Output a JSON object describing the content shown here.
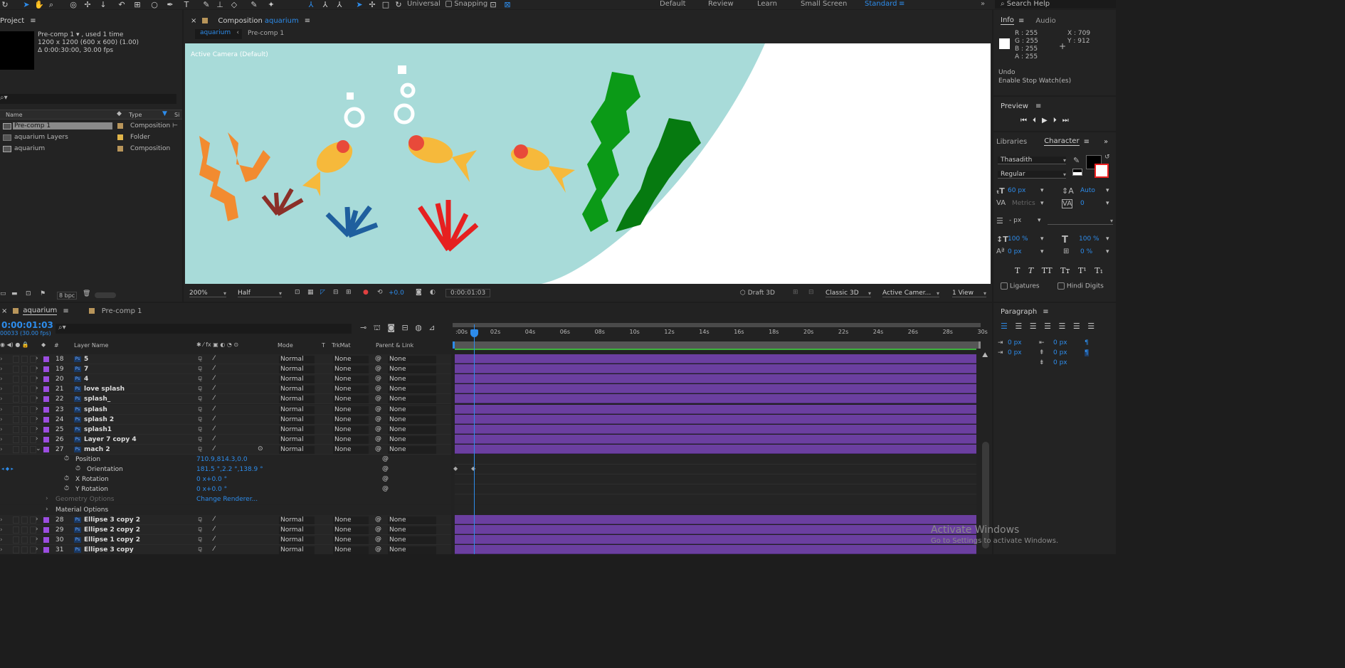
{
  "toolbar": {
    "universal": "Universal",
    "snapping": "Snapping"
  },
  "workspaces": [
    "Default",
    "Review",
    "Learn",
    "Small Screen",
    "Standard"
  ],
  "search_help": "Search Help",
  "project": {
    "title": "Project",
    "item_name": "Pre-comp 1 ▾ , used 1 time",
    "item_dims": "1200 x 1200  (600 x 600) (1.00)",
    "item_dur": "Δ 0:00:30:00, 30.00 fps",
    "col_name": "Name",
    "col_type": "Type",
    "col_size": "Si",
    "items": [
      {
        "name": "Pre-comp 1",
        "type": "Composition",
        "color": "#b8955a"
      },
      {
        "name": "aquarium Layers",
        "type": "Folder",
        "color": "#e0b54a"
      },
      {
        "name": "aquarium",
        "type": "Composition",
        "color": "#b8955a"
      }
    ],
    "bpc": "8 bpc"
  },
  "comp": {
    "title_prefix": "Composition",
    "title_name": "aquarium",
    "tab_active": "aquarium",
    "tab_other": "Pre-comp 1",
    "camera_label": "Active Camera (Default)",
    "zoom": "200%",
    "resolution": "Half",
    "exposure": "+0.0",
    "timecode": "0:00:01:03",
    "draft": "Draft 3D",
    "renderer": "Classic 3D",
    "camera": "Active Camer...",
    "views": "1 View"
  },
  "info": {
    "tab_info": "Info",
    "tab_audio": "Audio",
    "r": "R : 255",
    "g": "G : 255",
    "b": "B : 255",
    "a": "A : 255",
    "x": "X : 709",
    "y": "Y : 912",
    "undo": "Undo",
    "undo_action": "Enable Stop Watch(es)"
  },
  "preview": {
    "title": "Preview"
  },
  "character": {
    "tab_libraries": "Libraries",
    "tab_character": "Character",
    "font": "Thasadith",
    "style": "Regular",
    "size": "60 px",
    "leading": "Auto",
    "kerning": "Metrics",
    "tracking": "0",
    "stroke": "- px",
    "vscale": "100 %",
    "hscale": "100 %",
    "baseline": "0 px",
    "tsume": "0 %",
    "ligatures": "Ligatures",
    "hindi": "Hindi Digits"
  },
  "paragraph": {
    "title": "Paragraph",
    "v1": "0 px",
    "v2": "0 px",
    "v3": "0 px",
    "v4": "0 px",
    "v5": "0 px"
  },
  "timeline": {
    "tab_active": "aquarium",
    "tab_other": "Pre-comp 1",
    "timecode": "0:00:01:03",
    "frames": "00033 (30.00 fps)",
    "cols": {
      "num": "#",
      "name": "Layer Name",
      "mode": "Mode",
      "t": "T",
      "trkmat": "TrkMat",
      "parent": "Parent & Link"
    },
    "ruler": [
      ":00s",
      "02s",
      "04s",
      "06s",
      "08s",
      "10s",
      "12s",
      "14s",
      "16s",
      "18s",
      "20s",
      "22s",
      "24s",
      "26s",
      "28s",
      "30s"
    ],
    "layers": [
      {
        "num": "18",
        "name": "5",
        "mode": "Normal",
        "trk": "None",
        "parent": "None"
      },
      {
        "num": "19",
        "name": "7",
        "mode": "Normal",
        "trk": "None",
        "parent": "None"
      },
      {
        "num": "20",
        "name": "4",
        "mode": "Normal",
        "trk": "None",
        "parent": "None"
      },
      {
        "num": "21",
        "name": "love splash",
        "mode": "Normal",
        "trk": "None",
        "parent": "None"
      },
      {
        "num": "22",
        "name": "splash_",
        "mode": "Normal",
        "trk": "None",
        "parent": "None"
      },
      {
        "num": "23",
        "name": "splash",
        "mode": "Normal",
        "trk": "None",
        "parent": "None"
      },
      {
        "num": "24",
        "name": "splash 2",
        "mode": "Normal",
        "trk": "None",
        "parent": "None"
      },
      {
        "num": "25",
        "name": "splash1",
        "mode": "Normal",
        "trk": "None",
        "parent": "None"
      },
      {
        "num": "26",
        "name": "Layer 7 copy 4",
        "mode": "Normal",
        "trk": "None",
        "parent": "None"
      },
      {
        "num": "27",
        "name": "mach 2",
        "mode": "Normal",
        "trk": "None",
        "parent": "None"
      }
    ],
    "props": [
      {
        "name": "Position",
        "value": "710.9,814.3,0.0"
      },
      {
        "name": "Orientation",
        "value": "181.5 °,2.2 °,138.9 °"
      },
      {
        "name": "X Rotation",
        "value": "0 x+0.0 °"
      },
      {
        "name": "Y Rotation",
        "value": "0 x+0.0 °"
      }
    ],
    "geometry": "Geometry Options",
    "change_renderer": "Change Renderer...",
    "material": "Material Options",
    "layers2": [
      {
        "num": "28",
        "name": "Ellipse 3 copy 2",
        "mode": "Normal",
        "trk": "None",
        "parent": "None"
      },
      {
        "num": "29",
        "name": "Ellipse 2 copy 2",
        "mode": "Normal",
        "trk": "None",
        "parent": "None"
      },
      {
        "num": "30",
        "name": "Ellipse 1 copy 2",
        "mode": "Normal",
        "trk": "None",
        "parent": "None"
      },
      {
        "num": "31",
        "name": "Ellipse 3 copy",
        "mode": "Normal",
        "trk": "None",
        "parent": "None"
      }
    ]
  },
  "watermark": {
    "title": "Activate Windows",
    "sub": "Go to Settings to activate Windows."
  },
  "colors": {
    "label_purple": "#9b4de0",
    "bar_purple": "#6b3fa0",
    "accent_blue": "#2d8ceb",
    "water": "#a8dbd9"
  }
}
